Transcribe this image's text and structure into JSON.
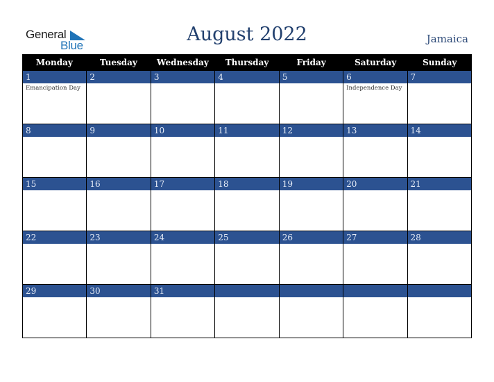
{
  "logo": {
    "general": "General",
    "blue": "Blue",
    "icon": "triangle-flag-icon"
  },
  "header": {
    "title": "August 2022",
    "country": "Jamaica"
  },
  "days_of_week": [
    "Monday",
    "Tuesday",
    "Wednesday",
    "Thursday",
    "Friday",
    "Saturday",
    "Sunday"
  ],
  "weeks": [
    [
      {
        "day": "1",
        "event": "Emancipation Day"
      },
      {
        "day": "2",
        "event": ""
      },
      {
        "day": "3",
        "event": ""
      },
      {
        "day": "4",
        "event": ""
      },
      {
        "day": "5",
        "event": ""
      },
      {
        "day": "6",
        "event": "Independence Day"
      },
      {
        "day": "7",
        "event": ""
      }
    ],
    [
      {
        "day": "8",
        "event": ""
      },
      {
        "day": "9",
        "event": ""
      },
      {
        "day": "10",
        "event": ""
      },
      {
        "day": "11",
        "event": ""
      },
      {
        "day": "12",
        "event": ""
      },
      {
        "day": "13",
        "event": ""
      },
      {
        "day": "14",
        "event": ""
      }
    ],
    [
      {
        "day": "15",
        "event": ""
      },
      {
        "day": "16",
        "event": ""
      },
      {
        "day": "17",
        "event": ""
      },
      {
        "day": "18",
        "event": ""
      },
      {
        "day": "19",
        "event": ""
      },
      {
        "day": "20",
        "event": ""
      },
      {
        "day": "21",
        "event": ""
      }
    ],
    [
      {
        "day": "22",
        "event": ""
      },
      {
        "day": "23",
        "event": ""
      },
      {
        "day": "24",
        "event": ""
      },
      {
        "day": "25",
        "event": ""
      },
      {
        "day": "26",
        "event": ""
      },
      {
        "day": "27",
        "event": ""
      },
      {
        "day": "28",
        "event": ""
      }
    ],
    [
      {
        "day": "29",
        "event": ""
      },
      {
        "day": "30",
        "event": ""
      },
      {
        "day": "31",
        "event": ""
      },
      {
        "day": "",
        "event": ""
      },
      {
        "day": "",
        "event": ""
      },
      {
        "day": "",
        "event": ""
      },
      {
        "day": "",
        "event": ""
      }
    ]
  ],
  "colors": {
    "accent_blue": "#2c5291",
    "header_black": "#000000",
    "title_color": "#22406e",
    "logo_blue": "#1f73b7"
  }
}
